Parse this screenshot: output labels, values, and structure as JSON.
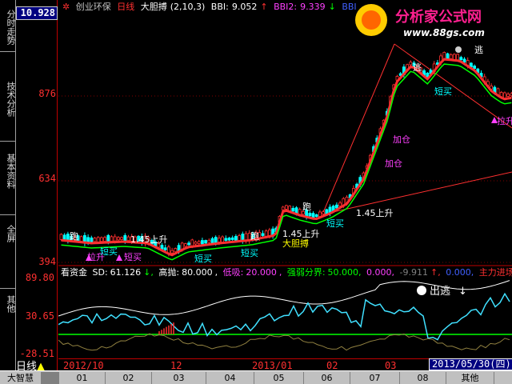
{
  "sidebar": {
    "tabs": [
      {
        "label": "分时走势"
      },
      {
        "label": "技术分析"
      },
      {
        "label": "基本资料"
      },
      {
        "label": "全屏"
      },
      {
        "label": "其他"
      }
    ]
  },
  "price_axis": {
    "current": "10.928",
    "labels": [
      "876",
      "634",
      "394"
    ]
  },
  "title_bar": {
    "stock": "创业环保",
    "period": "日线",
    "indicator": "大胆搏",
    "params": "(2,10,3)",
    "bbi_label": "BBI:",
    "bbi_value": "9.052",
    "bbi2_label": "BBI2:",
    "bbi2_value": "9.339",
    "bbi3_label": "BBI"
  },
  "logo": {
    "title": "分析家公式网",
    "url": "www.88gs.com"
  },
  "annotations": {
    "run": "跑",
    "up145": "1.45上升",
    "pull": "拉升",
    "short_buy": "短买",
    "add": "加仓",
    "flee": "逃",
    "big_bet": "大胆搏",
    "run_away": "出逃"
  },
  "indicator_bar": {
    "name": "看资金",
    "sd_label": "SD:",
    "sd_value": "61.126",
    "high_label": "高抛:",
    "high_value": "80.000",
    "low_label": "低吸:",
    "low_value": "20.000",
    "split_label": "强弱分界:",
    "split_value": "50.000,",
    "v1": "0.000,",
    "v2": "-9.911",
    "v3": "0.000,",
    "main_label": "主力进场"
  },
  "indicator_axis": [
    "89.80",
    "30.65",
    "-28.51"
  ],
  "date_bar": {
    "period_label": "日线",
    "labels": [
      "2012/10",
      "12",
      "2013/01",
      "02",
      "03"
    ],
    "current_date": "2013/05/30(四)"
  },
  "bottom_bar": {
    "app": "大智慧",
    "tabs": [
      "01",
      "02",
      "03",
      "04",
      "05",
      "06",
      "07",
      "08",
      "其他"
    ]
  },
  "colors": {
    "up": "#ff3030",
    "down": "#00ffff",
    "ma_green": "#00ff00",
    "annotation": "#ff40ff",
    "axis": "#c00000"
  }
}
